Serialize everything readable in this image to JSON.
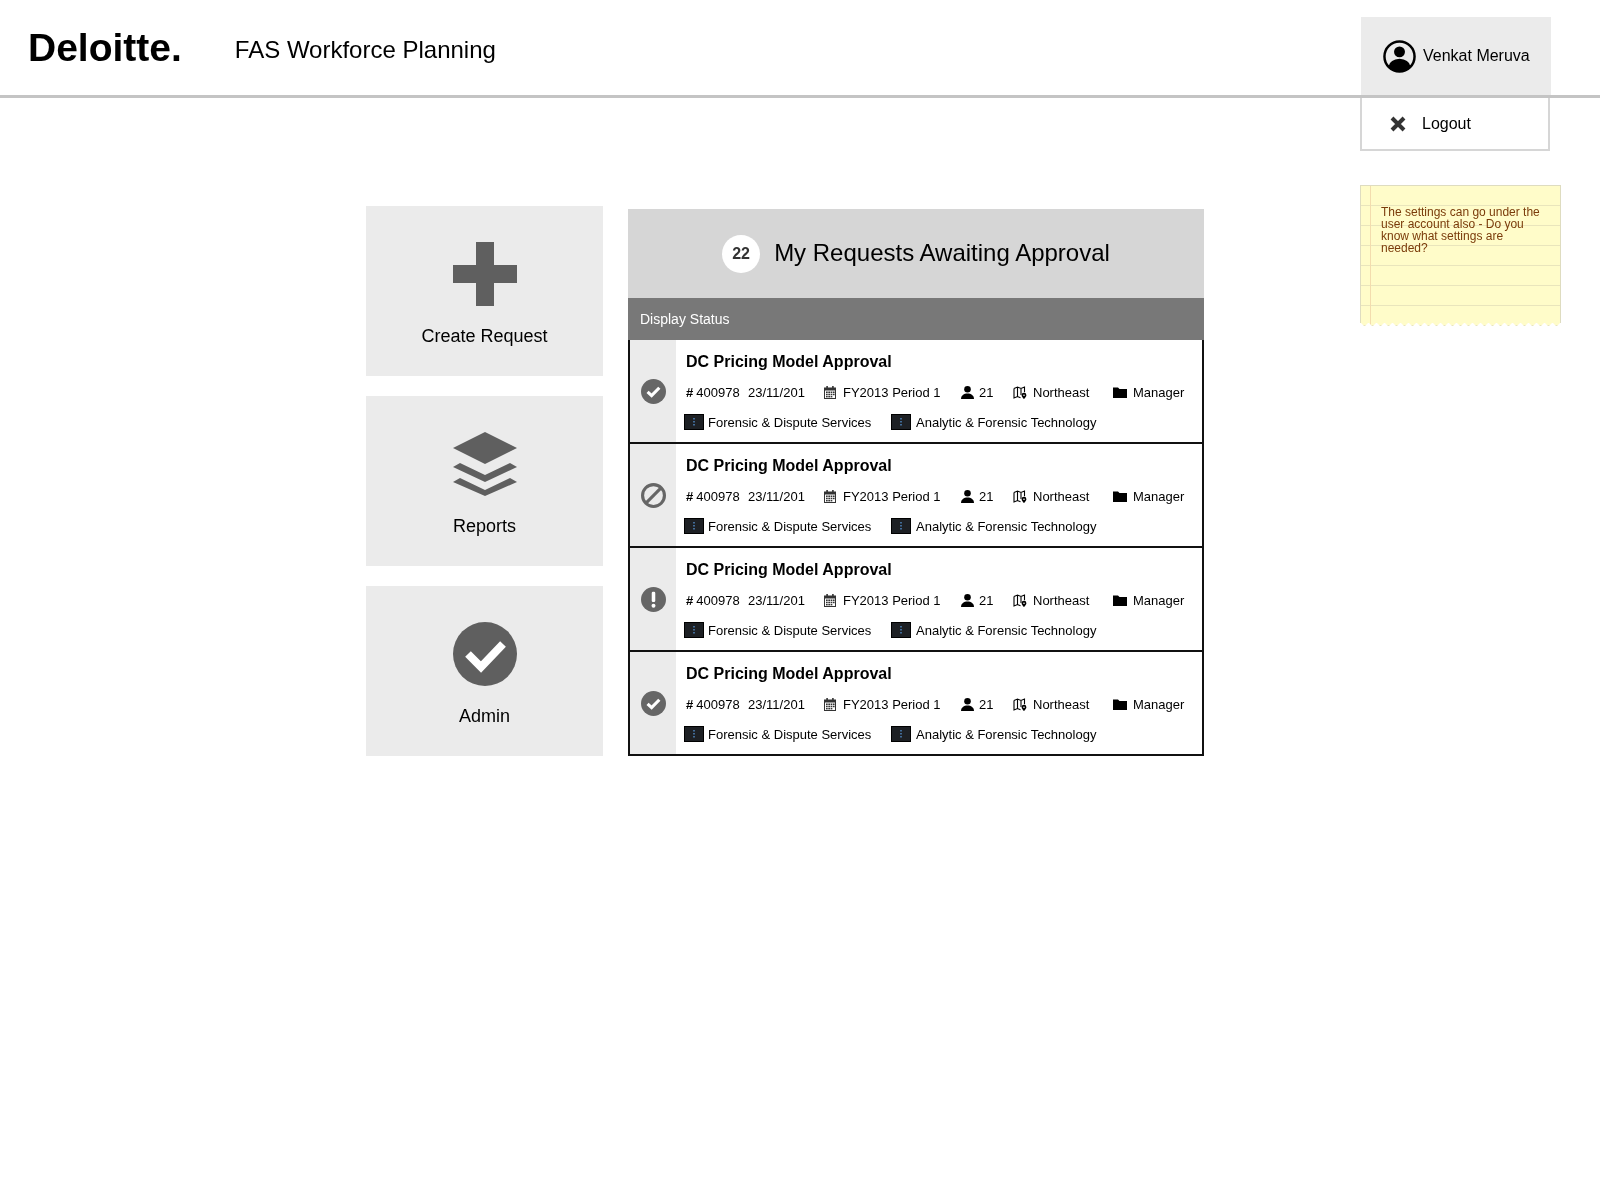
{
  "header": {
    "logo": "Deloitte.",
    "app_title": "FAS Workforce Planning"
  },
  "user_menu": {
    "user_name": "Venkat Meruva",
    "logout_label": "Logout"
  },
  "tiles": [
    {
      "kind": "create",
      "label": "Create Request"
    },
    {
      "kind": "reports",
      "label": "Reports"
    },
    {
      "kind": "admin",
      "label": "Admin"
    }
  ],
  "requests_panel": {
    "count": "22",
    "title": "My Requests Awaiting Approval",
    "status_bar_label": "Display Status",
    "requests": [
      {
        "kind": "approved",
        "title": "DC Pricing Model Approval",
        "number_prefix": "#",
        "number": "400978",
        "date": "23/11/201",
        "period": "FY2013 Period 1",
        "headcount": "21",
        "region": "Northeast",
        "role": "Manager",
        "service_line": "Forensic & Dispute Services",
        "sub_service_line": "Analytic & Forensic Technology"
      },
      {
        "kind": "rejected",
        "title": "DC Pricing Model Approval",
        "number_prefix": "#",
        "number": "400978",
        "date": "23/11/201",
        "period": "FY2013 Period 1",
        "headcount": "21",
        "region": "Northeast",
        "role": "Manager",
        "service_line": "Forensic & Dispute Services",
        "sub_service_line": "Analytic & Forensic Technology"
      },
      {
        "kind": "flagged",
        "title": "DC Pricing Model Approval",
        "number_prefix": "#",
        "number": "400978",
        "date": "23/11/201",
        "period": "FY2013 Period 1",
        "headcount": "21",
        "region": "Northeast",
        "role": "Manager",
        "service_line": "Forensic & Dispute Services",
        "sub_service_line": "Analytic & Forensic Technology"
      },
      {
        "kind": "approved",
        "title": "DC Pricing Model Approval",
        "number_prefix": "#",
        "number": "400978",
        "date": "23/11/201",
        "period": "FY2013 Period 1",
        "headcount": "21",
        "region": "Northeast",
        "role": "Manager",
        "service_line": "Forensic & Dispute Services",
        "sub_service_line": "Analytic & Forensic Technology"
      }
    ]
  },
  "sticky_note": {
    "text": "The settings can go under the user account also - Do you know what settings are needed?"
  }
}
